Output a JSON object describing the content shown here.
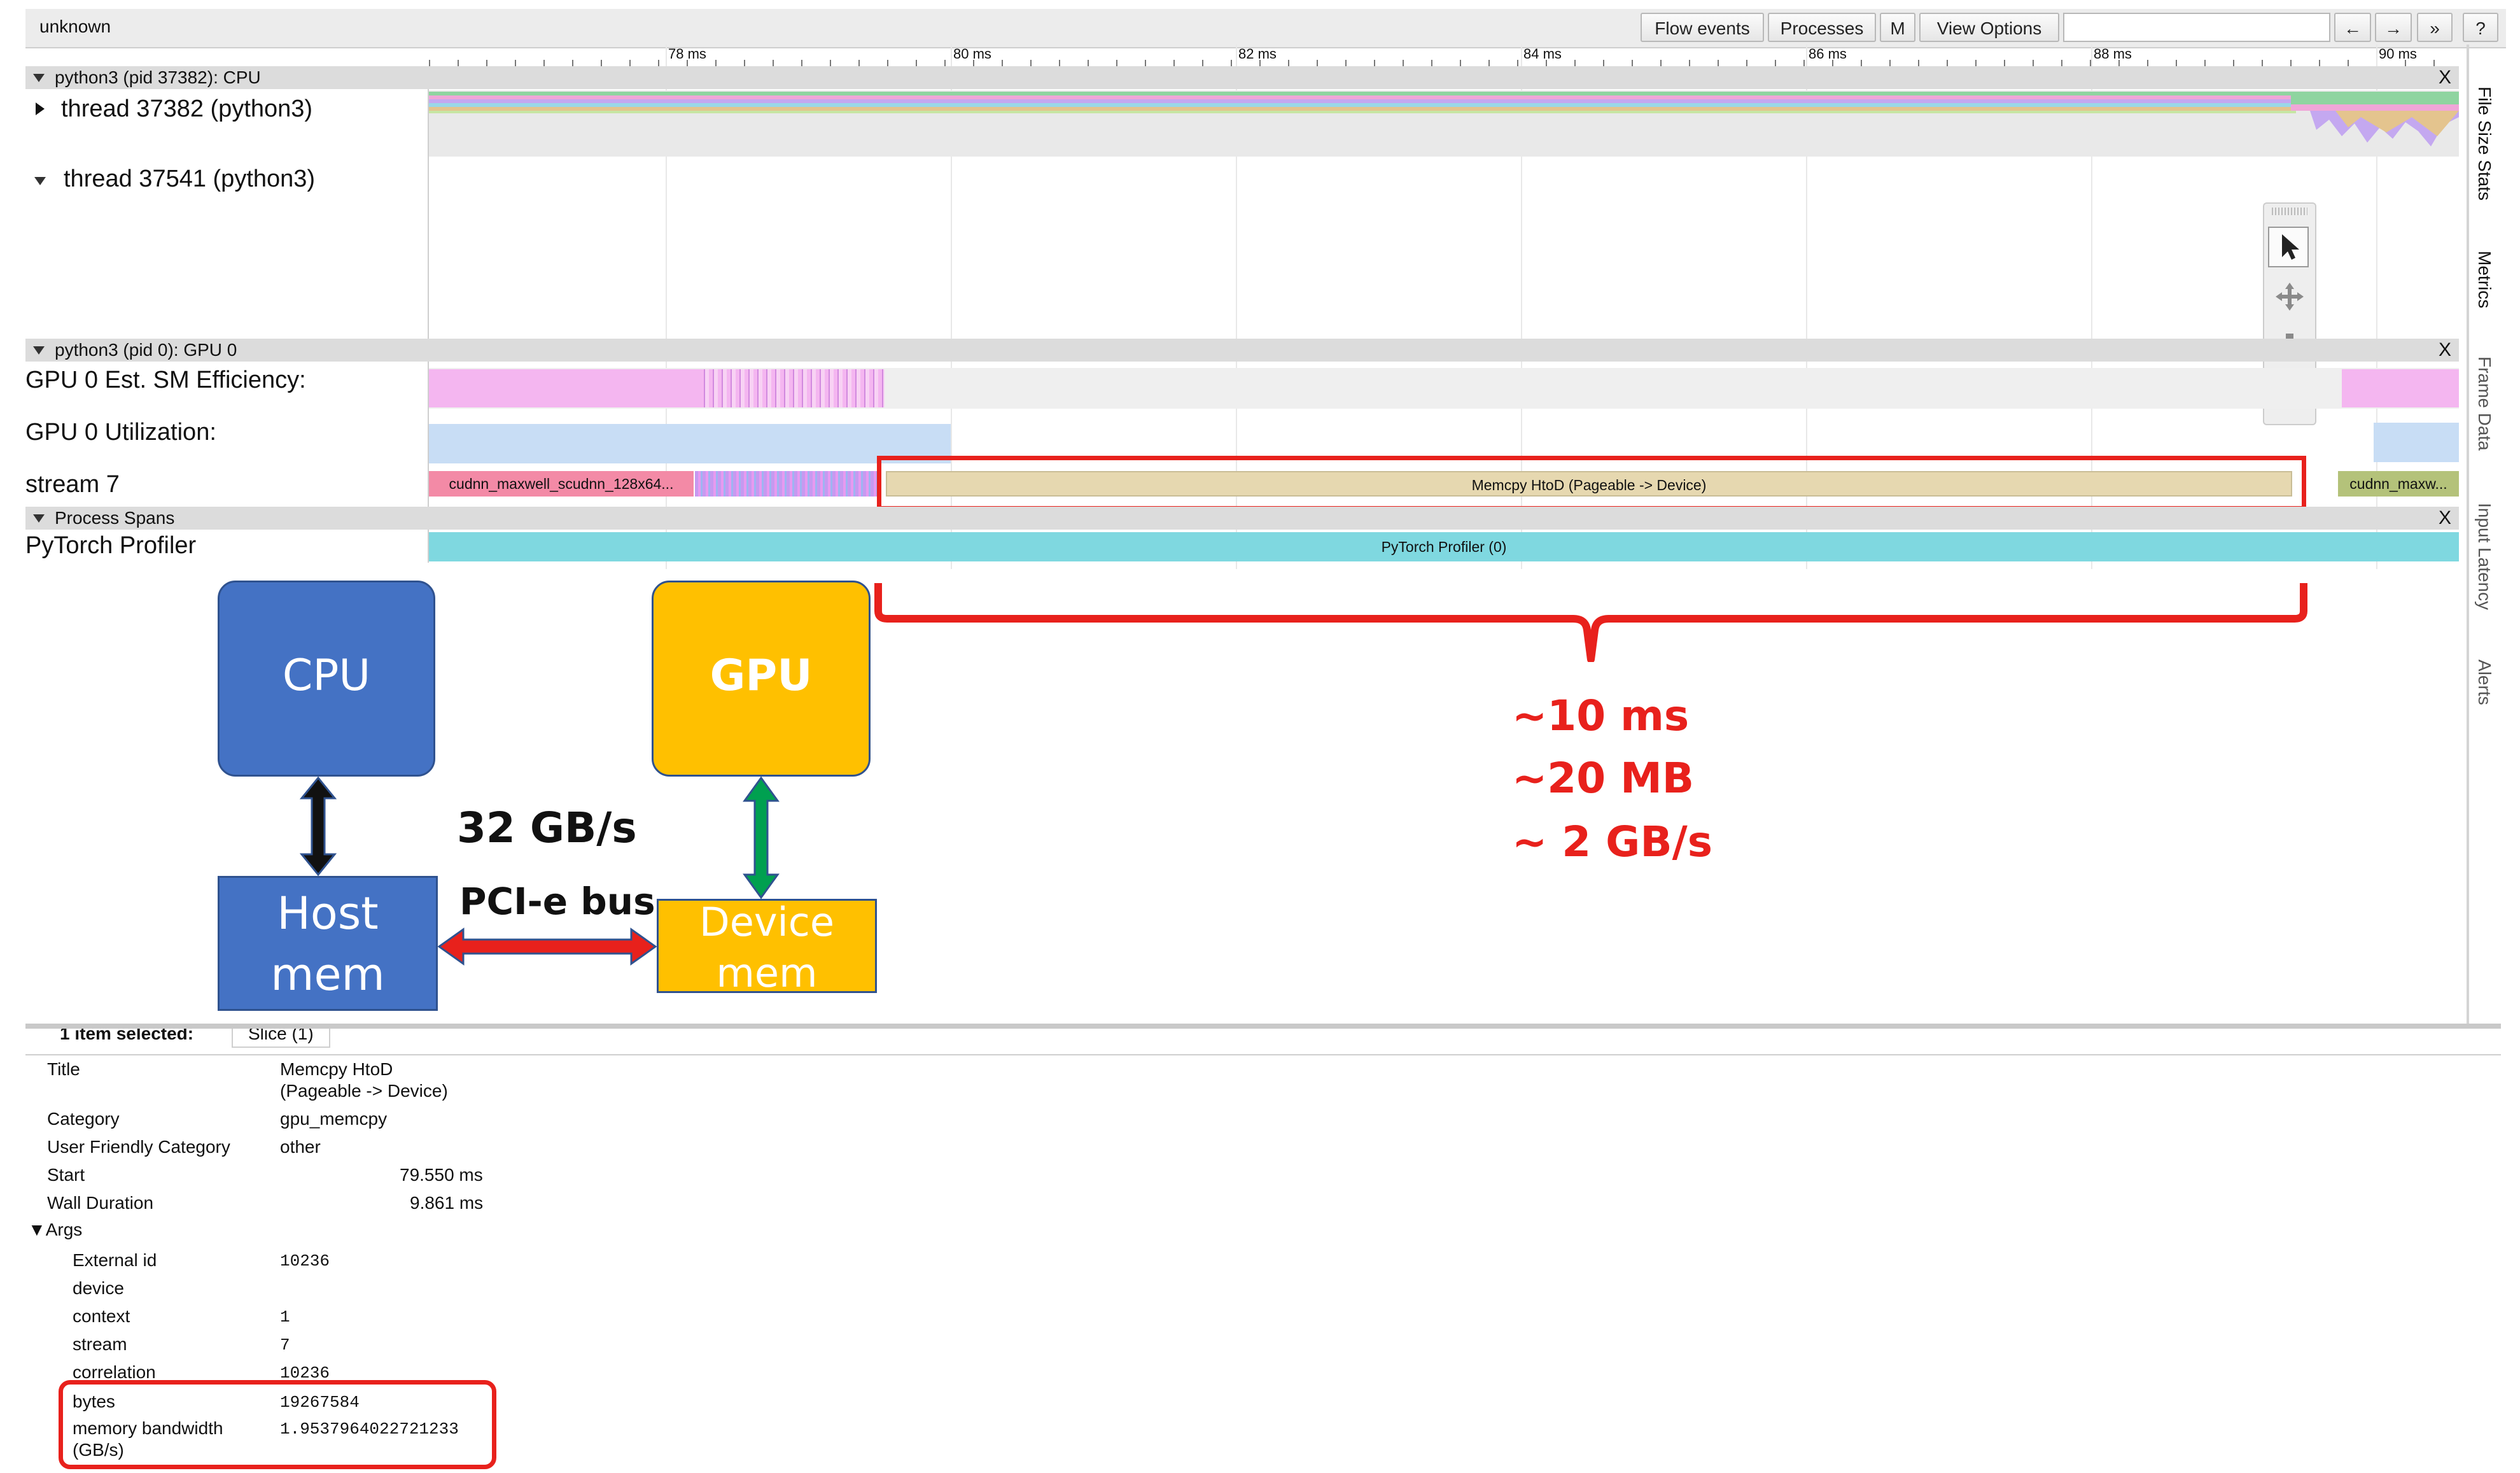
{
  "window": {
    "title": "unknown"
  },
  "toolbar": {
    "flow_events": "Flow events",
    "processes": "Processes",
    "m": "M",
    "view_options": "View Options",
    "search_placeholder": "",
    "prev": "←",
    "next": "→",
    "more": "»",
    "help": "?"
  },
  "ruler": {
    "ticks": [
      "78 ms",
      "80 ms",
      "82 ms",
      "84 ms",
      "86 ms",
      "88 ms",
      "90 ms"
    ]
  },
  "groups": {
    "cpu": {
      "label": "python3 (pid 37382): CPU",
      "close": "X"
    },
    "gpu": {
      "label": "python3 (pid 0): GPU 0",
      "close": "X"
    },
    "spans": {
      "label": "Process Spans",
      "close": "X"
    }
  },
  "rows": {
    "thread1": "thread 37382 (python3)",
    "thread2": "thread 37541 (python3)",
    "sm_eff": "GPU 0 Est. SM Efficiency:",
    "util": "GPU 0 Utilization:",
    "stream": "stream 7",
    "profiler": "PyTorch Profiler"
  },
  "slices": {
    "cudnn1": "cudnn_maxwell_scudnn_128x64...",
    "memcpy": "Memcpy HtoD (Pageable -> Device)",
    "cudnn2": "cudnn_maxw...",
    "profiler": "PyTorch Profiler (0)"
  },
  "side_tabs": [
    "File Size Stats",
    "Metrics",
    "Frame Data",
    "Input Latency",
    "Alerts"
  ],
  "diagram": {
    "cpu": "CPU",
    "gpu": "GPU",
    "host_mem": [
      "Host",
      "mem"
    ],
    "device_mem": [
      "Device",
      "mem"
    ],
    "bandwidth": "32 GB/s",
    "bus": "PCI-e bus",
    "annotation": [
      "~10 ms",
      "~20 MB",
      "~ 2 GB/s"
    ]
  },
  "details": {
    "tab1": "1 item selected:",
    "tab2": "Slice (1)",
    "fields": [
      {
        "key": "Title",
        "value": [
          "Memcpy HtoD",
          "(Pageable -> Device)"
        ]
      },
      {
        "key": "Category",
        "value": "gpu_memcpy"
      },
      {
        "key": "User Friendly Category",
        "value": "other"
      },
      {
        "key": "Start",
        "value": "79.550 ms"
      },
      {
        "key": "Wall Duration",
        "value": "9.861 ms"
      }
    ],
    "args_label": "▼Args",
    "args": [
      {
        "key": "External id",
        "value": "10236"
      },
      {
        "key": "device",
        "value": ""
      },
      {
        "key": "context",
        "value": "1"
      },
      {
        "key": "stream",
        "value": "7"
      },
      {
        "key": "correlation",
        "value": "10236"
      },
      {
        "key": "bytes",
        "value": "19267584"
      },
      {
        "key": "memory bandwidth",
        "key2": "(GB/s)",
        "value": "1.9537964022721233"
      }
    ]
  },
  "colors": {
    "annotation_red": "#e8211c",
    "cpu_box": "#4472c4",
    "gpu_box": "#ffc000",
    "memcpy_slice": "#e6d8b0",
    "sm_eff": "#f4b6f0",
    "utilization": "#c8ddf5",
    "profiler_span": "#7fd8e0"
  }
}
